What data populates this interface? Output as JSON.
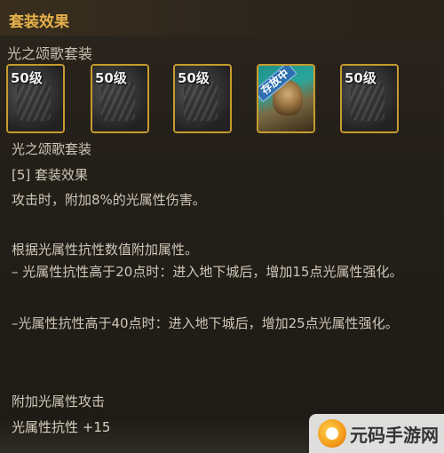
{
  "tooltip": {
    "section_title": "套装效果",
    "set_name": "光之颂歌套装",
    "items": [
      {
        "level": "50级",
        "icon": "armor-piece-icon"
      },
      {
        "level": "50级",
        "icon": "armor-piece-icon"
      },
      {
        "level": "50级",
        "icon": "armor-piece-icon"
      },
      {
        "level": "",
        "icon": "creature-equipment-icon",
        "badge": "存放中"
      },
      {
        "level": "50级",
        "icon": "armor-piece-icon"
      }
    ],
    "detail": {
      "set_name": "光之颂歌套装",
      "bonus_header": "[5] 套装效果",
      "bonus_line": "攻击时，附加8%的光属性伤害。",
      "attr_header": "根据光属性抗性数值附加属性。",
      "attr_rule_1": "– 光属性抗性高于20点时：进入地下城后，增加15点光属性强化。",
      "attr_rule_2": "–光属性抗性高于40点时：进入地下城后，增加25点光属性强化。",
      "attack_header": "附加光属性攻击",
      "resist_line": "光属性抗性 +15"
    }
  },
  "watermark": {
    "text": "元码手游网"
  }
}
